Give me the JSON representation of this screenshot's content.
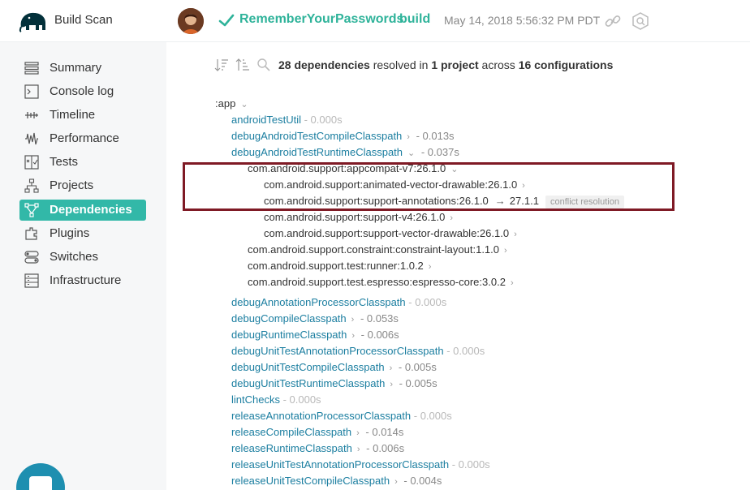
{
  "header": {
    "brand": "Build Scan",
    "project": "RememberYourPasswords",
    "task": "build",
    "timestamp": "May 14, 2018 5:56:32 PM PDT",
    "icons": [
      "gradle-elephant-icon",
      "user-avatar",
      "success-check-icon",
      "link-icon",
      "search-icon"
    ]
  },
  "sidebar": {
    "items": [
      {
        "label": "Summary",
        "icon": "summary-icon"
      },
      {
        "label": "Console log",
        "icon": "console-icon"
      },
      {
        "label": "Timeline",
        "icon": "timeline-icon"
      },
      {
        "label": "Performance",
        "icon": "performance-icon"
      },
      {
        "label": "Tests",
        "icon": "tests-icon"
      },
      {
        "label": "Projects",
        "icon": "projects-icon"
      },
      {
        "label": "Dependencies",
        "icon": "dependencies-icon",
        "active": true
      },
      {
        "label": "Plugins",
        "icon": "plugins-icon"
      },
      {
        "label": "Switches",
        "icon": "switches-icon"
      },
      {
        "label": "Infrastructure",
        "icon": "infrastructure-icon"
      }
    ],
    "accent": "#32b8a8"
  },
  "summary": {
    "count": "28 dependencies",
    "resolved_in": " resolved in ",
    "projects": "1 project",
    "across": " across ",
    "configurations": "16 configurations"
  },
  "tree": {
    "root": ":app",
    "rows": [
      {
        "name": "androidTestUtil",
        "time": " - 0.000s",
        "muted": true
      },
      {
        "name": "debugAndroidTestCompileClasspath",
        "time": " - 0.013s"
      },
      {
        "name": "debugAndroidTestRuntimeClasspath",
        "time": " - 0.037s"
      },
      {
        "name": "com.android.support:appcompat-v7:26.1.0"
      },
      {
        "name": "com.android.support:animated-vector-drawable:26.1.0"
      },
      {
        "name": "com.android.support:support-annotations:26.1.0",
        "resolved": "27.1.1",
        "badge": "conflict resolution"
      },
      {
        "name": "com.android.support:support-v4:26.1.0"
      },
      {
        "name": "com.android.support:support-vector-drawable:26.1.0"
      },
      {
        "name": "com.android.support.constraint:constraint-layout:1.1.0"
      },
      {
        "name": "com.android.support.test:runner:1.0.2"
      },
      {
        "name": "com.android.support.test.espresso:espresso-core:3.0.2"
      },
      {
        "name": "debugAnnotationProcessorClasspath",
        "time": " - 0.000s",
        "muted": true
      },
      {
        "name": "debugCompileClasspath",
        "time": " - 0.053s"
      },
      {
        "name": "debugRuntimeClasspath",
        "time": " - 0.006s"
      },
      {
        "name": "debugUnitTestAnnotationProcessorClasspath",
        "time": " - 0.000s",
        "muted": true
      },
      {
        "name": "debugUnitTestCompileClasspath",
        "time": " - 0.005s"
      },
      {
        "name": "debugUnitTestRuntimeClasspath",
        "time": " - 0.005s"
      },
      {
        "name": "lintChecks",
        "time": " - 0.000s",
        "muted": true
      },
      {
        "name": "releaseAnnotationProcessorClasspath",
        "time": " - 0.000s",
        "muted": true
      },
      {
        "name": "releaseCompileClasspath",
        "time": " - 0.014s"
      },
      {
        "name": "releaseRuntimeClasspath",
        "time": " - 0.006s"
      },
      {
        "name": "releaseUnitTestAnnotationProcessorClasspath",
        "time": " - 0.000s",
        "muted": true
      },
      {
        "name": "releaseUnitTestCompileClasspath",
        "time": " - 0.004s"
      }
    ]
  },
  "colors": {
    "accent": "#2fb39a",
    "link": "#1b7ea0",
    "highlight_border": "#7f1a25"
  }
}
